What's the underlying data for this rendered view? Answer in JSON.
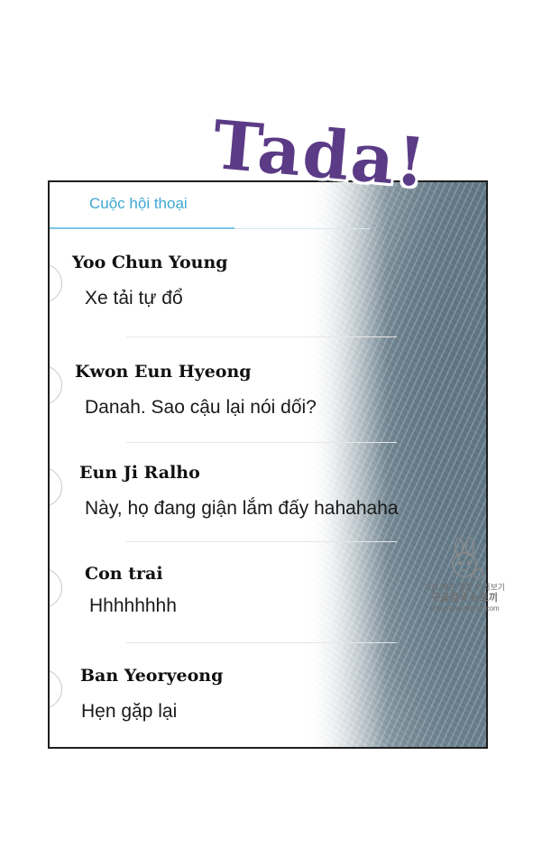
{
  "title": "Tada!",
  "conversation_tab": "Cuộc hội thoại",
  "messages": [
    {
      "name": "Yoo Chun Young",
      "text": "Xe tải tự đổ"
    },
    {
      "name": "Kwon Eun Hyeong",
      "text": "Danah. Sao cậu lại nói dối?"
    },
    {
      "name": "Eun Ji Ralho",
      "text": "Này, họ đang giận lắm đấy hahahaha"
    },
    {
      "name": "Con trai",
      "text": "Hhhhhhhh"
    },
    {
      "name": "Ban Yeoryeong",
      "text": "Hẹn gặp lại"
    }
  ],
  "watermark": {
    "line1": "가장 빠른 웹툰 미리보기",
    "line2": "구글검색 뉴토끼",
    "line3": "https://newtoki12.com"
  },
  "colors": {
    "title": "#5b3b86",
    "tab": "#3ea7d2",
    "texture": "#5d7482"
  }
}
